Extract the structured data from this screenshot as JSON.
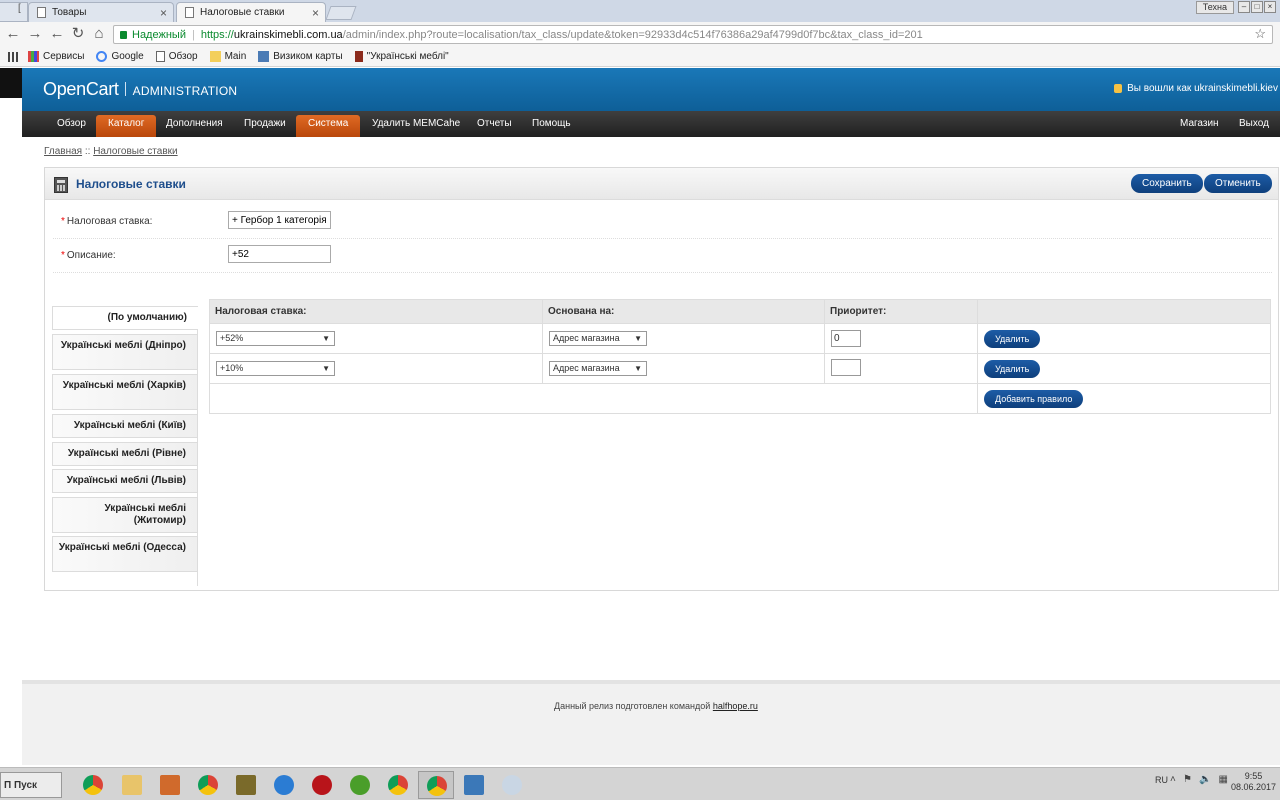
{
  "browser": {
    "tab_fragment": "[",
    "tabs": [
      {
        "title": "Товары"
      },
      {
        "title": "Налоговые ставки"
      }
    ],
    "window_user": "Техна",
    "secure_label": "Надежный",
    "url_scheme": "https://",
    "url_host": "ukrainskimebli.com.ua",
    "url_path": "/admin/index.php?route=localisation/tax_class/update&token=92933d4c514f76386a29af4799d0f7bc&tax_class_id=201",
    "bookmarks": [
      {
        "label": "Сервисы",
        "icon": "apps-icon"
      },
      {
        "label": "Google",
        "icon": "google-icon"
      },
      {
        "label": "Обзор",
        "icon": "page-icon"
      },
      {
        "label": "Main",
        "icon": "folder-icon"
      },
      {
        "label": "Визиком карты",
        "icon": "map-icon"
      },
      {
        "label": "\"Українські меблі\"",
        "icon": "horse-icon"
      }
    ]
  },
  "header": {
    "logo": "OpenCart",
    "admin_label": "ADMINISTRATION",
    "login_text": "Вы вошли как ukrainskimebli.kiev"
  },
  "menu": {
    "left": [
      "Обзор",
      "Каталог",
      "Дополнения",
      "Продажи",
      "Система",
      "Удалить MEMCahe",
      "Отчеты",
      "Помощь"
    ],
    "right": [
      "Магазин",
      "Выход"
    ]
  },
  "breadcrumb": {
    "home": "Главная",
    "separator": "::",
    "current": "Налоговые ставки"
  },
  "page": {
    "title": "Налоговые ставки",
    "save_label": "Сохранить",
    "cancel_label": "Отменить"
  },
  "form": {
    "tax_rate_label": "Налоговая ставка:",
    "tax_rate_value": "+ Гербор 1 категорія",
    "description_label": "Описание:",
    "description_value": "+52"
  },
  "stores": [
    "(По умолчанию)",
    "Українські меблі (Дніпро)",
    "Українські меблі (Харків)",
    "Українські меблі (Київ)",
    "Українські меблі (Рівне)",
    "Українські меблі (Львів)",
    "Українські меблі (Житомир)",
    "Українські меблі (Одесса)"
  ],
  "rules_table": {
    "headers": [
      "Налоговая ставка:",
      "Основана на:",
      "Приоритет:",
      ""
    ],
    "rows": [
      {
        "rate": "+52%",
        "based_on": "Адрес магазина",
        "priority": "0",
        "delete_label": "Удалить"
      },
      {
        "rate": "+10%",
        "based_on": "Адрес магазина",
        "priority": "",
        "delete_label": "Удалить"
      }
    ],
    "add_rule_label": "Добавить правило"
  },
  "footer": {
    "text": "Данный релиз подготовлен командой",
    "link": "halfhope.ru"
  },
  "taskbar": {
    "start_label": "Пуск",
    "start_prefix": "П",
    "lang": "RU",
    "time": "9:55",
    "date": "08.06.2017"
  },
  "colors": {
    "header_blue": "#1a78b8",
    "menu_dark": "#2f2f2f",
    "menu_active": "#d35f1c",
    "button_blue": "#174f92",
    "title_blue": "#1e4e8c"
  }
}
